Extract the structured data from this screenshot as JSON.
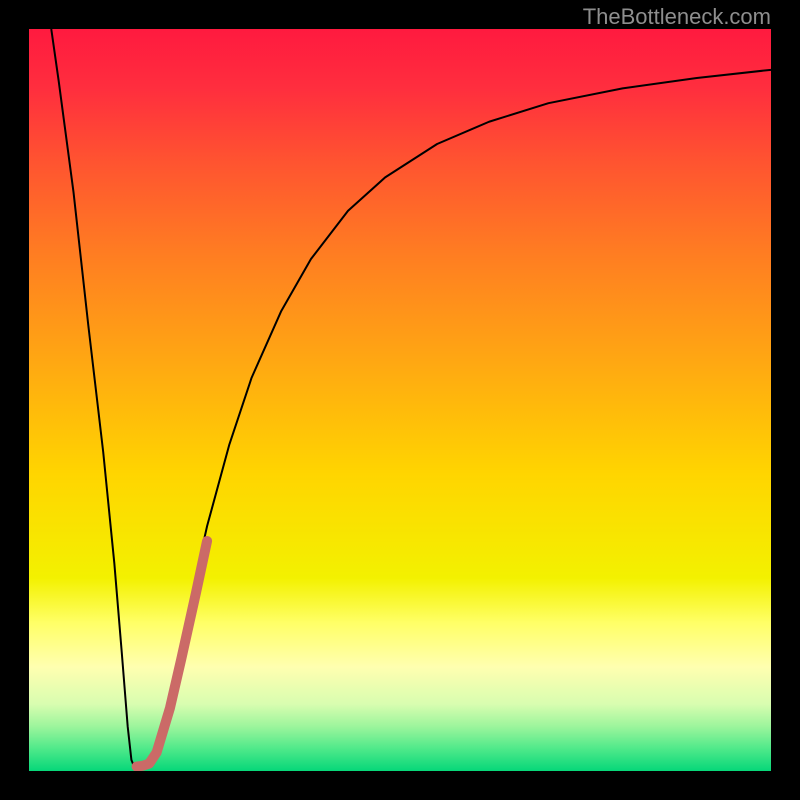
{
  "watermark": {
    "text": "TheBottleneck.com"
  },
  "chart_data": {
    "type": "line",
    "title": "",
    "xlabel": "",
    "ylabel": "",
    "xlim": [
      0,
      100
    ],
    "ylim": [
      0,
      100
    ],
    "background_gradient": {
      "stops": [
        {
          "pos": 0.0,
          "color": "#ff1a3f"
        },
        {
          "pos": 0.08,
          "color": "#ff2e3e"
        },
        {
          "pos": 0.18,
          "color": "#ff5430"
        },
        {
          "pos": 0.3,
          "color": "#ff7c22"
        },
        {
          "pos": 0.45,
          "color": "#ffa812"
        },
        {
          "pos": 0.6,
          "color": "#ffd500"
        },
        {
          "pos": 0.74,
          "color": "#f3f100"
        },
        {
          "pos": 0.8,
          "color": "#ffff66"
        },
        {
          "pos": 0.86,
          "color": "#ffffb0"
        },
        {
          "pos": 0.91,
          "color": "#d8fdb0"
        },
        {
          "pos": 0.94,
          "color": "#9cf59c"
        },
        {
          "pos": 0.97,
          "color": "#4fe98a"
        },
        {
          "pos": 1.0,
          "color": "#06d779"
        }
      ]
    },
    "series": [
      {
        "name": "bottleneck-curve",
        "color": "#000000",
        "stroke_width": 2,
        "points": [
          {
            "x": 3.0,
            "y": 100.0
          },
          {
            "x": 4.0,
            "y": 93.0
          },
          {
            "x": 6.0,
            "y": 78.0
          },
          {
            "x": 8.0,
            "y": 60.0
          },
          {
            "x": 10.0,
            "y": 43.0
          },
          {
            "x": 11.5,
            "y": 28.0
          },
          {
            "x": 12.5,
            "y": 16.0
          },
          {
            "x": 13.3,
            "y": 6.0
          },
          {
            "x": 13.8,
            "y": 1.5
          },
          {
            "x": 14.2,
            "y": 0.5
          },
          {
            "x": 16.0,
            "y": 0.8
          },
          {
            "x": 18.0,
            "y": 6.0
          },
          {
            "x": 20.0,
            "y": 15.0
          },
          {
            "x": 22.0,
            "y": 24.0
          },
          {
            "x": 24.0,
            "y": 33.0
          },
          {
            "x": 27.0,
            "y": 44.0
          },
          {
            "x": 30.0,
            "y": 53.0
          },
          {
            "x": 34.0,
            "y": 62.0
          },
          {
            "x": 38.0,
            "y": 69.0
          },
          {
            "x": 43.0,
            "y": 75.5
          },
          {
            "x": 48.0,
            "y": 80.0
          },
          {
            "x": 55.0,
            "y": 84.5
          },
          {
            "x": 62.0,
            "y": 87.5
          },
          {
            "x": 70.0,
            "y": 90.0
          },
          {
            "x": 80.0,
            "y": 92.0
          },
          {
            "x": 90.0,
            "y": 93.4
          },
          {
            "x": 100.0,
            "y": 94.5
          }
        ]
      },
      {
        "name": "highlight-segment",
        "color": "#cb6a67",
        "stroke_width": 10,
        "linecap": "round",
        "points": [
          {
            "x": 14.5,
            "y": 0.6
          },
          {
            "x": 15.3,
            "y": 0.7
          },
          {
            "x": 16.2,
            "y": 1.0
          },
          {
            "x": 17.2,
            "y": 2.5
          },
          {
            "x": 19.0,
            "y": 8.5
          },
          {
            "x": 20.5,
            "y": 15.0
          },
          {
            "x": 22.5,
            "y": 24.0
          },
          {
            "x": 24.0,
            "y": 31.0
          }
        ]
      }
    ]
  }
}
